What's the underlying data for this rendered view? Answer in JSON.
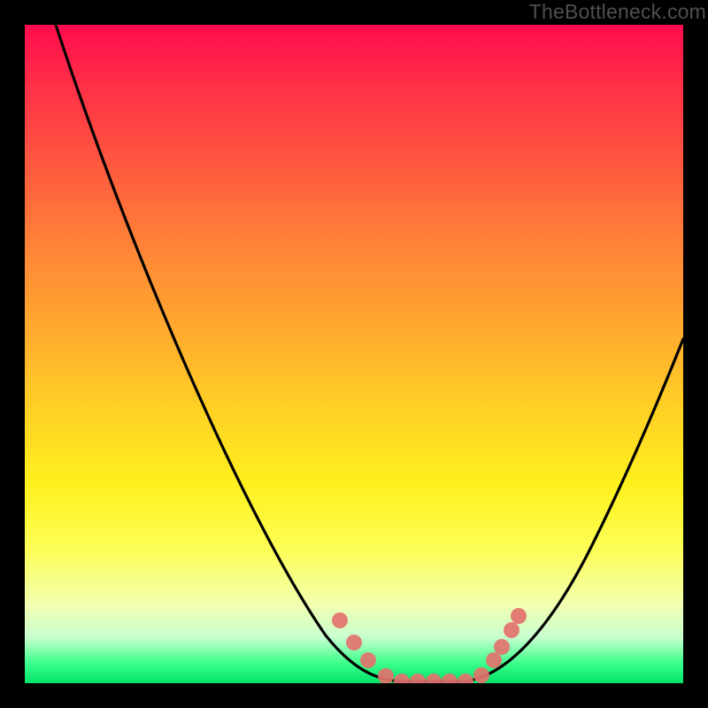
{
  "watermark": {
    "text": "TheBottleneck.com"
  },
  "chart_data": {
    "type": "line",
    "title": "",
    "xlabel": "",
    "ylabel": "",
    "xlim": [
      0,
      100
    ],
    "ylim": [
      0,
      100
    ],
    "legend": false,
    "grid": false,
    "gradient_stops": [
      {
        "pos": 0,
        "color": "#ff0b4e"
      },
      {
        "pos": 20,
        "color": "#ff5440"
      },
      {
        "pos": 45,
        "color": "#ffa62f"
      },
      {
        "pos": 70,
        "color": "#fff11e"
      },
      {
        "pos": 88,
        "color": "#f2ffb0"
      },
      {
        "pos": 97,
        "color": "#3bff8a"
      },
      {
        "pos": 100,
        "color": "#00e36a"
      }
    ],
    "series": [
      {
        "name": "bottleneck-curve",
        "x": [
          5,
          10,
          15,
          20,
          25,
          30,
          35,
          40,
          44,
          48,
          52,
          56,
          60,
          62,
          66,
          70,
          75,
          80,
          85,
          90,
          95,
          100
        ],
        "y": [
          100,
          88,
          76,
          65,
          54,
          44,
          34,
          25,
          17,
          10,
          5,
          2,
          0,
          0,
          0,
          2,
          6,
          13,
          21,
          30,
          40,
          50
        ]
      }
    ],
    "markers": {
      "name": "highlight-dots",
      "color": "#e3736e",
      "points": [
        {
          "x": 48,
          "y": 10
        },
        {
          "x": 50,
          "y": 6
        },
        {
          "x": 52,
          "y": 4
        },
        {
          "x": 55,
          "y": 1
        },
        {
          "x": 57,
          "y": 0
        },
        {
          "x": 59,
          "y": 0
        },
        {
          "x": 61,
          "y": 0
        },
        {
          "x": 63,
          "y": 0
        },
        {
          "x": 65,
          "y": 0
        },
        {
          "x": 68,
          "y": 1
        },
        {
          "x": 70,
          "y": 3
        },
        {
          "x": 71,
          "y": 5
        },
        {
          "x": 73,
          "y": 8
        },
        {
          "x": 74,
          "y": 10
        }
      ]
    }
  }
}
